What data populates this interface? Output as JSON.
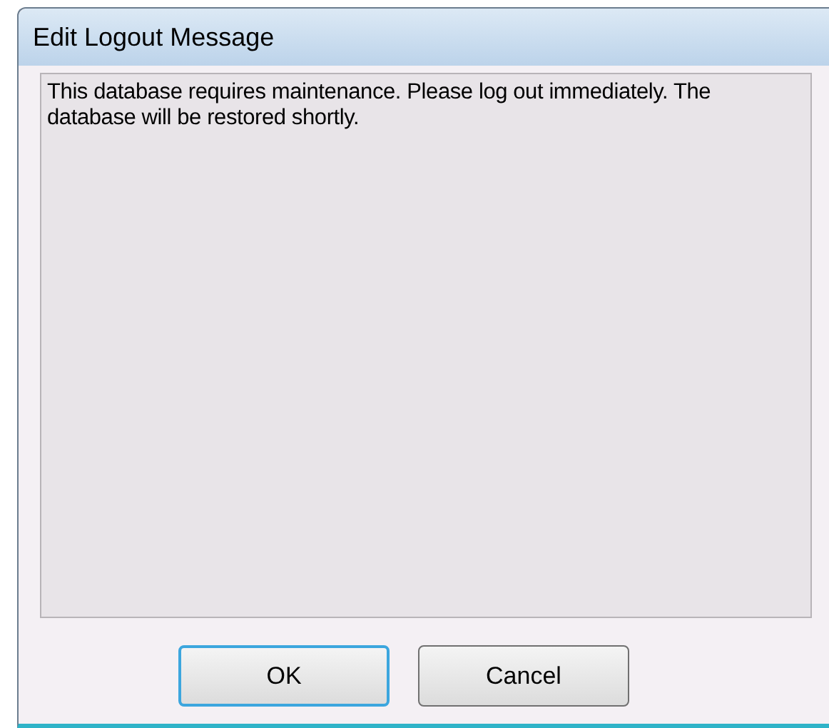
{
  "window": {
    "title": "Edit Logout Message"
  },
  "message": {
    "value": "This database requires maintenance. Please log out immediately. The database will be restored shortly."
  },
  "buttons": [
    {
      "label": "OK",
      "default": true
    },
    {
      "label": "Cancel",
      "default": false
    }
  ]
}
